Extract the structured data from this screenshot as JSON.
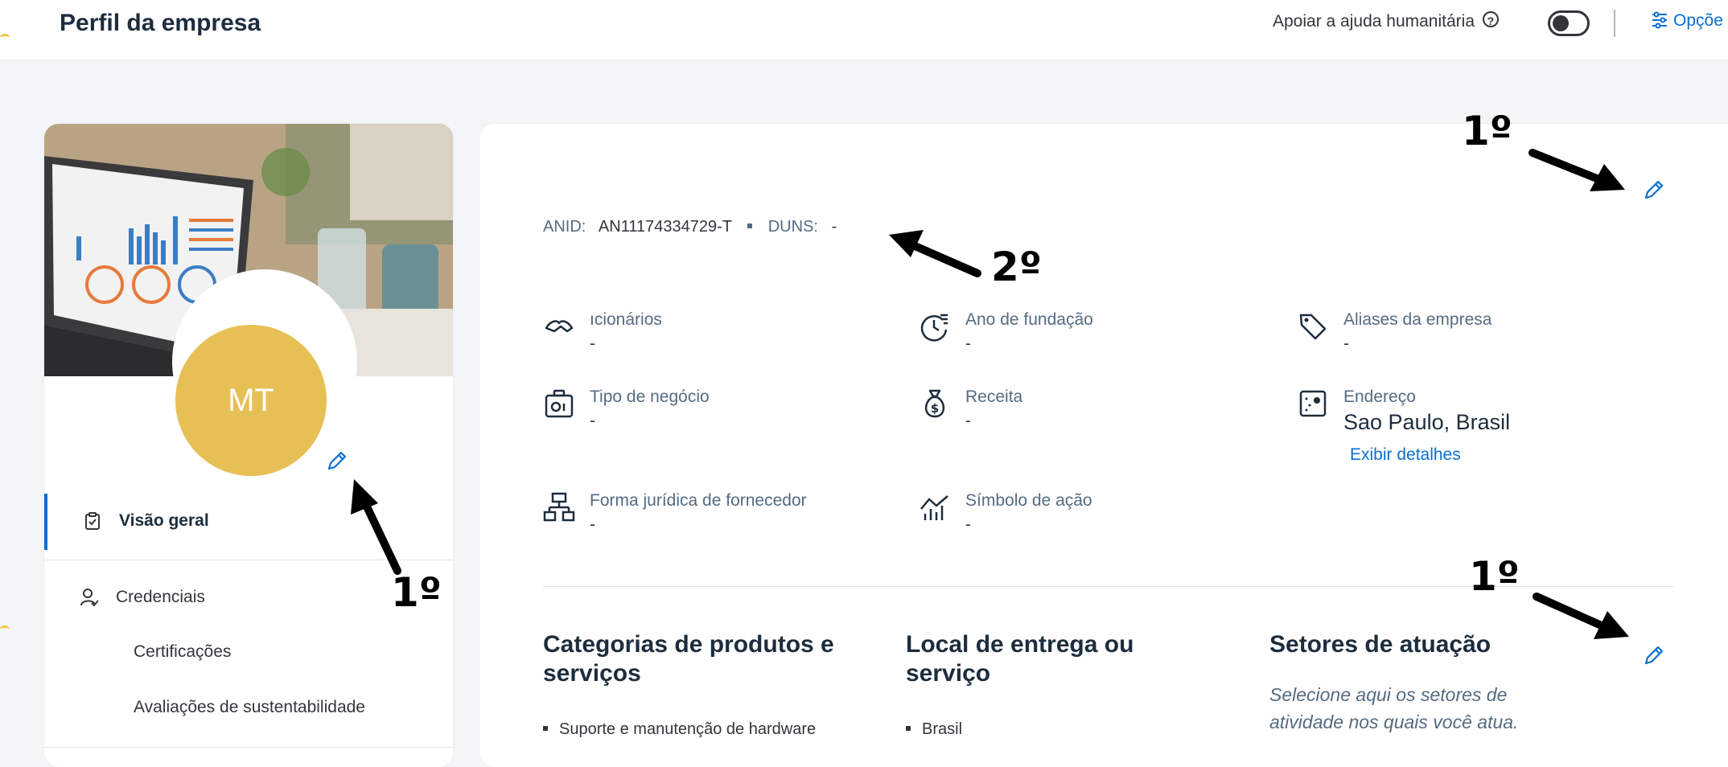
{
  "header": {
    "page_title": "Perfil da empresa",
    "help_text": "Apoiar a ajuda humanitária",
    "help_icon": "?",
    "options_label": "Opçõe"
  },
  "left_card": {
    "avatar_initials": "MT",
    "nav": [
      {
        "label": "Visão geral",
        "icon": "clipboard-check-icon",
        "active": true
      },
      {
        "label": "Credenciais",
        "icon": "person-check-icon",
        "active": false
      }
    ],
    "sub_items": [
      "Certificações",
      "Avaliações de sustentabilidade"
    ]
  },
  "main_card": {
    "anid_label": "ANID:",
    "anid_value": "AN11174334729-T",
    "duns_label": "DUNS:",
    "duns_value": "-",
    "fields": [
      {
        "label": "ıcionários",
        "value": "-",
        "icon": "handshake-icon"
      },
      {
        "label": "Ano de fundação",
        "value": "-",
        "icon": "clock-history-icon"
      },
      {
        "label": "Aliases da empresa",
        "value": "-",
        "icon": "tag-icon"
      },
      {
        "label": "Tipo de negócio",
        "value": "-",
        "icon": "briefcase-icon"
      },
      {
        "label": "Receita",
        "value": "-",
        "icon": "money-bag-icon"
      },
      {
        "label": "Endereço",
        "value": "Sao Paulo, Brasil",
        "link": "Exibir detalhes",
        "icon": "map-icon"
      },
      {
        "label": "Forma jurídica de fornecedor",
        "value": "-",
        "icon": "org-chart-icon"
      },
      {
        "label": "Símbolo de ação",
        "value": "-",
        "icon": "stock-chart-icon"
      }
    ],
    "sections": [
      {
        "title": "Categorias de produtos e serviços",
        "items": [
          "Suporte e manutenção de hardware"
        ]
      },
      {
        "title": "Local de entrega ou serviço",
        "items": [
          "Brasil"
        ]
      },
      {
        "title": "Setores de atuação",
        "hint": "Selecione aqui os setores de atividade nos quais você atua."
      }
    ]
  },
  "annotations": {
    "first": "1º",
    "second": "2º"
  },
  "colors": {
    "accent": "#0a6ed1",
    "avatar": "#e7c055",
    "background": "#f4f5f7"
  }
}
